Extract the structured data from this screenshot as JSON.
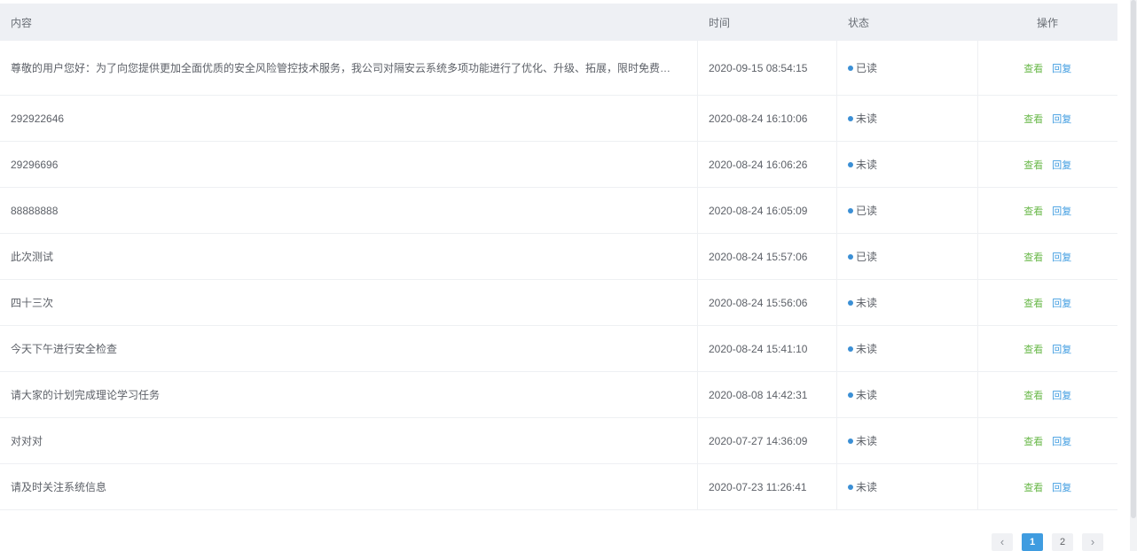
{
  "table": {
    "headers": {
      "content": "内容",
      "time": "时间",
      "status": "状态",
      "actions": "操作"
    },
    "action_labels": {
      "view": "查看",
      "reply": "回复"
    },
    "rows": [
      {
        "content": "尊敬的用户您好：为了向您提供更加全面优质的安全风险管控技术服务，我公司对隔安云系统多项功能进行了优化、升级、拓展，限时免费…",
        "time": "2020-09-15 08:54:15",
        "status": "已读"
      },
      {
        "content": "292922646",
        "time": "2020-08-24 16:10:06",
        "status": "未读"
      },
      {
        "content": "29296696",
        "time": "2020-08-24 16:06:26",
        "status": "未读"
      },
      {
        "content": "88888888",
        "time": "2020-08-24 16:05:09",
        "status": "已读"
      },
      {
        "content": "此次测试",
        "time": "2020-08-24 15:57:06",
        "status": "已读"
      },
      {
        "content": "四十三次",
        "time": "2020-08-24 15:56:06",
        "status": "未读"
      },
      {
        "content": "今天下午进行安全检查",
        "time": "2020-08-24 15:41:10",
        "status": "未读"
      },
      {
        "content": "请大家的计划完成理论学习任务",
        "time": "2020-08-08 14:42:31",
        "status": "未读"
      },
      {
        "content": "对对对",
        "time": "2020-07-27 14:36:09",
        "status": "未读"
      },
      {
        "content": "请及时关注系统信息",
        "time": "2020-07-23 11:26:41",
        "status": "未读"
      }
    ]
  },
  "pagination": {
    "prev": "‹",
    "pages": [
      "1",
      "2"
    ],
    "current": "1",
    "next": "›"
  },
  "colors": {
    "header_bg": "#eef0f4",
    "status_dot": "#3b8fd5",
    "view_link": "#6ab84a",
    "reply_link": "#3f9ce0",
    "active_page": "#3f9ce0"
  }
}
